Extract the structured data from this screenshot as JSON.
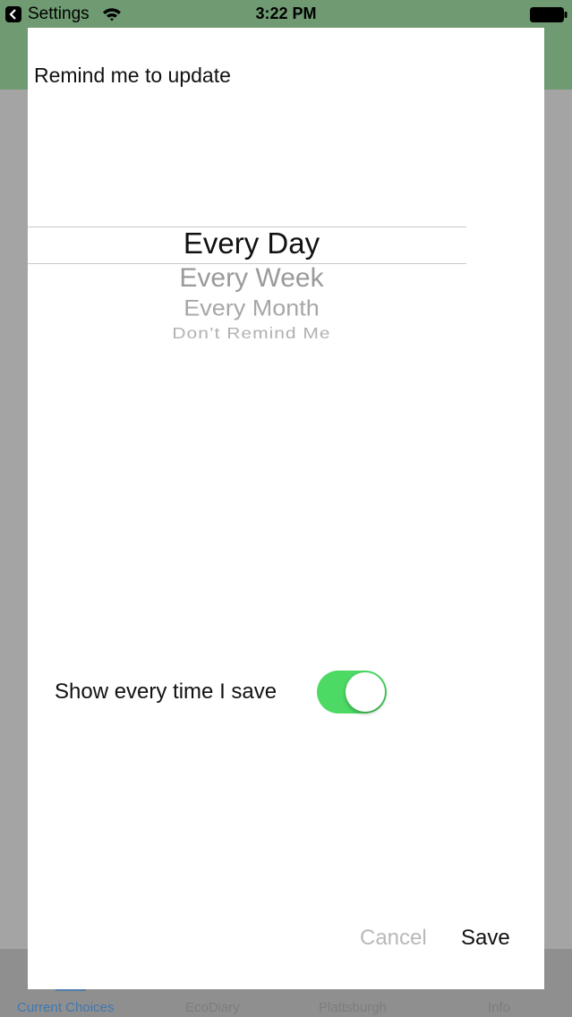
{
  "status_bar": {
    "back_app_label": "Settings",
    "time": "3:22 PM",
    "icons": [
      "back-chevron-icon",
      "wifi-icon",
      "battery-icon"
    ]
  },
  "modal": {
    "title": "Remind me to update",
    "picker": {
      "selected": "Every Day",
      "options": [
        "Every Day",
        "Every Week",
        "Every Month",
        "Don’t Remind Me"
      ]
    },
    "toggle": {
      "label": "Show every time I save",
      "on": true,
      "color": "#4cd964"
    },
    "buttons": {
      "cancel": "Cancel",
      "save": "Save"
    }
  },
  "background_tabs": {
    "items": [
      "Current Choices",
      "EcoDiary",
      "Plattsburgh",
      "Info"
    ],
    "active": "Current Choices",
    "accent": "#3f78b2"
  }
}
